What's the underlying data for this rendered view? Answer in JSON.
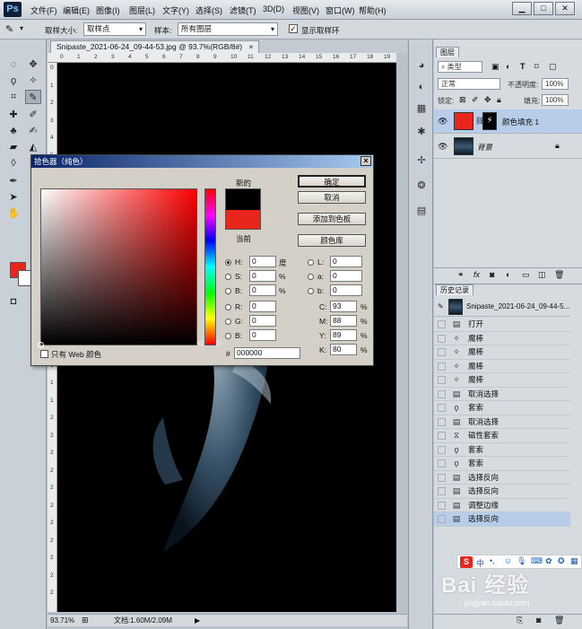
{
  "app": {
    "logo": "Ps"
  },
  "menu": [
    "文件(F)",
    "编辑(E)",
    "图像(I)",
    "图层(L)",
    "文字(Y)",
    "选择(S)",
    "滤镜(T)",
    "3D(D)",
    "视图(V)",
    "窗口(W)",
    "帮助(H)"
  ],
  "window_controls": {
    "minimize": "▁",
    "maximize": "□",
    "close": "✕"
  },
  "options": {
    "sample_size_label": "取样大小:",
    "sample_size_value": "取样点",
    "sample_label": "样本:",
    "sample_value": "所有图层",
    "show_ring_label": "显示取样环",
    "show_ring_checked": true
  },
  "document": {
    "tab_title": "Snipaste_2021-06-24_09-44-53.jpg @ 93.7%(RGB/8#)",
    "tab_close": "×"
  },
  "ruler": {
    "h": [
      "0",
      "1",
      "2",
      "3",
      "4",
      "5",
      "6",
      "7",
      "8",
      "9",
      "10",
      "11",
      "12",
      "13",
      "14",
      "15",
      "16",
      "17",
      "18",
      "19",
      "2"
    ],
    "v": [
      "0",
      "1",
      "2",
      "3",
      "4",
      "5",
      "6",
      "7",
      "8",
      "9",
      "1",
      "1",
      "1",
      "1",
      "1",
      "1",
      "1",
      "1",
      "1",
      "1",
      "2",
      "2",
      "2",
      "2",
      "2",
      "2",
      "2",
      "2",
      "2",
      "2",
      "2"
    ]
  },
  "status": {
    "zoom": "93.71%",
    "doc": "文档:1.60M/2.09M"
  },
  "color_picker": {
    "title": "拾色器（纯色）",
    "new_label": "新的",
    "current_label": "当前",
    "new_color": "#000000",
    "current_color": "#e8261c",
    "buttons": {
      "ok": "确定",
      "cancel": "取消",
      "add_swatch": "添加到色板",
      "libraries": "颜色库"
    },
    "web_only": "只有 Web 颜色",
    "fields": {
      "H": "0",
      "H_unit": "度",
      "S": "0",
      "S_unit": "%",
      "B": "0",
      "B_unit": "%",
      "R": "0",
      "G": "0",
      "B2": "0",
      "L": "0",
      "a": "0",
      "b": "0",
      "C": "93",
      "M": "88",
      "Y": "89",
      "K": "80",
      "pct": "%",
      "hex_label": "#",
      "hex": "000000"
    },
    "labels": {
      "H": "H:",
      "S": "S:",
      "B": "B:",
      "R": "R:",
      "G": "G:",
      "B2": "B:",
      "L": "L:",
      "a": "a:",
      "b": "b:",
      "C": "C:",
      "M": "M:",
      "Y": "Y:",
      "K": "K:"
    }
  },
  "layers": {
    "tab": "图层",
    "kind_filter": "类型",
    "blend_mode": "正常",
    "opacity_label": "不透明度:",
    "opacity": "100%",
    "lock_label": "锁定:",
    "fill_label": "填充:",
    "fill": "100%",
    "items": [
      {
        "name": "颜色填充 1",
        "italic": false
      },
      {
        "name": "背景",
        "italic": true
      }
    ],
    "footer_icons": [
      "link-icon",
      "fx-icon",
      "mask-icon",
      "adjustment-icon",
      "group-icon",
      "new-layer-icon",
      "trash-icon"
    ]
  },
  "history": {
    "tab": "历史记录",
    "snapshot": "Snipaste_2021-06-24_09-44-5...",
    "items": [
      "打开",
      "魔棒",
      "魔棒",
      "魔棒",
      "魔棒",
      "取消选择",
      "套索",
      "取消选择",
      "磁性套索",
      "套索",
      "套索",
      "选择反向",
      "选择反向",
      "调整边缘",
      "选择反向"
    ],
    "selected_index": 14
  },
  "ime_bar": {
    "label": "中"
  },
  "watermark": {
    "main": "Bai 经验",
    "sub": "jingyan.baidu.com"
  },
  "colors": {
    "accent_red": "#e8261c",
    "selection_blue": "#b7cdea"
  }
}
